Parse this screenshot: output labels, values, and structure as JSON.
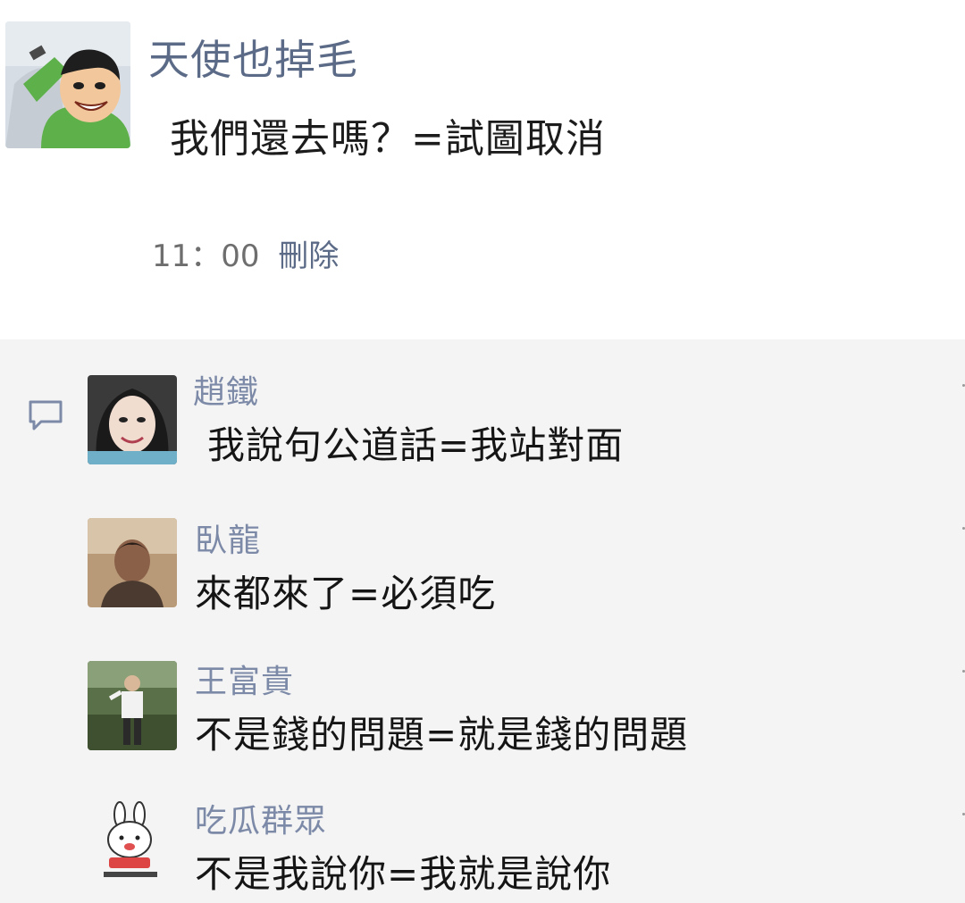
{
  "post": {
    "author": "天使也掉毛",
    "text": "我們還去嗎？=試圖取消",
    "time": "11：00",
    "delete_label": "刪除",
    "avatar_icon": "cartoon-avatar-icon"
  },
  "comments": [
    {
      "name": "趙鐵",
      "text": "我說句公道話=我站對面",
      "avatar_icon": "avatar-photo-icon"
    },
    {
      "name": "臥龍",
      "text": "來都來了=必須吃",
      "avatar_icon": "avatar-photo-icon"
    },
    {
      "name": "王富貴",
      "text": "不是錢的問題=就是錢的問題",
      "avatar_icon": "avatar-photo-icon"
    },
    {
      "name": "吃瓜群眾",
      "text": "不是我說你=我就是說你",
      "avatar_icon": "rabbit-sticker-icon"
    }
  ],
  "colors": {
    "name_link": "#5b6a86",
    "comment_bg": "#f4f4f4"
  }
}
